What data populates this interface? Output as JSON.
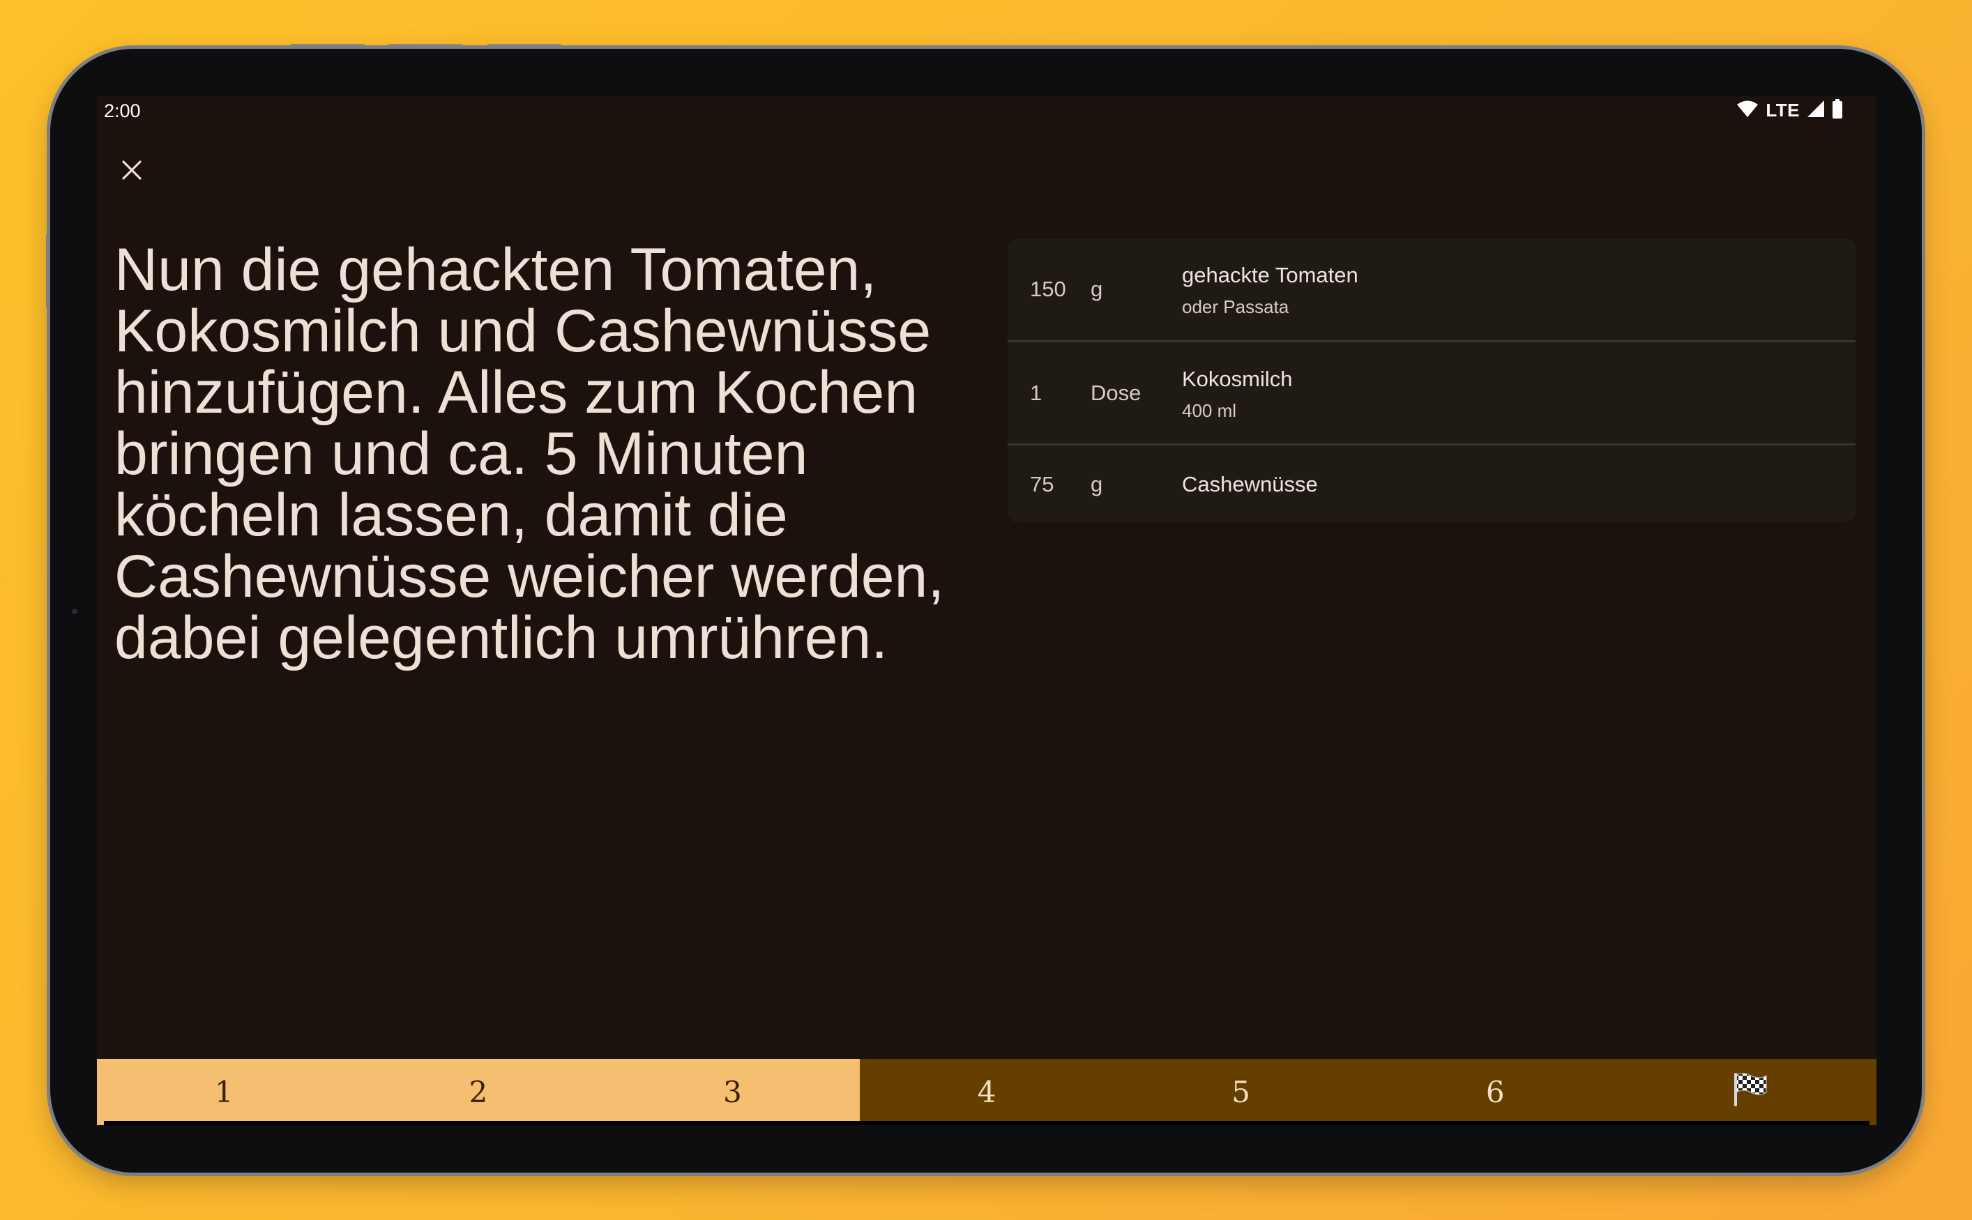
{
  "status_bar": {
    "time": "2:00",
    "network": "LTE"
  },
  "step": {
    "current": 4,
    "total": 6,
    "instruction": "Nun die gehackten Tomaten, Kokosmilch und Cashewnüsse hinzufügen. Alles zum Kochen bringen und ca. 5 Minuten köcheln lassen, damit die Cashewnüsse weicher werden, dabei gelegentlich umrühren."
  },
  "ingredients": [
    {
      "qty": "150",
      "unit": "g",
      "name": "gehackte Tomaten",
      "note": "oder Passata"
    },
    {
      "qty": "1",
      "unit": "Dose",
      "name": "Kokosmilch",
      "note": "400 ml"
    },
    {
      "qty": "75",
      "unit": "g",
      "name": "Cashewnüsse",
      "note": ""
    }
  ],
  "stepper": {
    "steps": [
      "1",
      "2",
      "3",
      "4",
      "5",
      "6"
    ],
    "completed_count": 3,
    "finish_icon": "checkered-flag-icon"
  },
  "colors": {
    "background_outer": "#fcc028",
    "screen_background": "#1b120d",
    "step_done": "#f5bf72",
    "step_todo": "#643f00",
    "ingredient_card": "#201a15"
  }
}
